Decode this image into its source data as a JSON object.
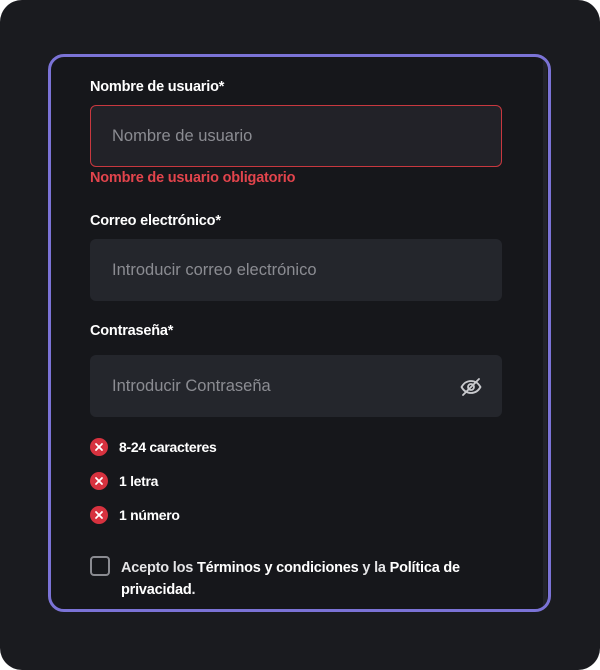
{
  "form": {
    "username": {
      "label": "Nombre de usuario*",
      "placeholder": "Nombre de usuario",
      "value": "",
      "error": "Nombre de usuario obligatorio"
    },
    "email": {
      "label": "Correo electrónico*",
      "placeholder": "Introducir correo electrónico",
      "value": ""
    },
    "password": {
      "label": "Contraseña*",
      "placeholder": "Introducir Contraseña",
      "value": "",
      "toggle_icon": "eye-off-icon"
    },
    "requirements": [
      {
        "text": "8-24 caracteres",
        "status": "unmet",
        "icon": "x-circle-icon"
      },
      {
        "text": "1 letra",
        "status": "unmet",
        "icon": "x-circle-icon"
      },
      {
        "text": "1 número",
        "status": "unmet",
        "icon": "x-circle-icon"
      }
    ],
    "terms": {
      "checked": false,
      "text_1": "Acepto los ",
      "link_terms": "Términos y condiciones",
      "text_2": " y la ",
      "link_privacy": "Política de privacidad",
      "text_3": "."
    }
  },
  "colors": {
    "background": "#1a1b1f",
    "frame_border": "#7b73d6",
    "input_bg": "#24262c",
    "error": "#e2444c",
    "badge_error": "#d7323f"
  }
}
